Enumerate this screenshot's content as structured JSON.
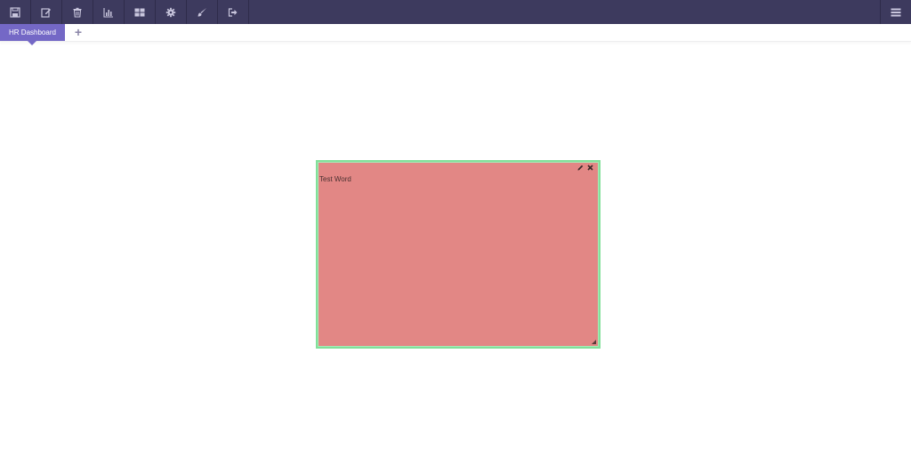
{
  "toolbar": {
    "buttons": [
      {
        "icon": "save-icon"
      },
      {
        "icon": "edit-icon"
      },
      {
        "icon": "trash-icon"
      },
      {
        "icon": "bar-chart-icon"
      },
      {
        "icon": "grid-icon"
      },
      {
        "icon": "gear-icon"
      },
      {
        "icon": "brush-icon"
      },
      {
        "icon": "sign-out-icon"
      }
    ],
    "right_button": {
      "icon": "menu-list-icon"
    }
  },
  "tabs": {
    "active_label": "HR Dashboard",
    "add_label": "+"
  },
  "widget": {
    "text": "Test Word",
    "actions": [
      {
        "icon": "pencil-icon"
      },
      {
        "icon": "close-icon"
      }
    ]
  },
  "colors": {
    "toolbar_bg": "#3d3a5e",
    "tab_active": "#7468c6",
    "widget_bg": "#e28785",
    "widget_border": "#82e09a"
  }
}
